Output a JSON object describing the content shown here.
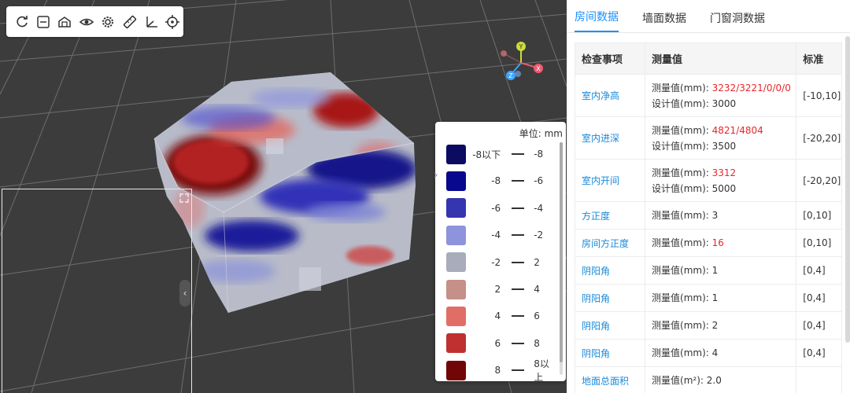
{
  "toolbar": {
    "tools": [
      {
        "name": "reset-view",
        "icon": "refresh-icon"
      },
      {
        "name": "minimize",
        "icon": "minus-square-icon"
      },
      {
        "name": "house-view",
        "icon": "house-icon"
      },
      {
        "name": "visibility",
        "icon": "eye-icon"
      },
      {
        "name": "settings",
        "icon": "gear-icon"
      },
      {
        "name": "measure",
        "icon": "ruler-icon"
      },
      {
        "name": "axes",
        "icon": "axes-icon"
      },
      {
        "name": "locate",
        "icon": "crosshair-icon"
      }
    ]
  },
  "gizmo": {
    "y": "Y",
    "x": "X",
    "z": "Z"
  },
  "legend": {
    "unit": "单位: mm",
    "rows": [
      {
        "lo": "-8以下",
        "hi": "-8",
        "color": "#0b0b62"
      },
      {
        "lo": "-8",
        "hi": "-6",
        "color": "#08088e"
      },
      {
        "lo": "-6",
        "hi": "-4",
        "color": "#3535b0"
      },
      {
        "lo": "-4",
        "hi": "-2",
        "color": "#8d93dc"
      },
      {
        "lo": "-2",
        "hi": "2",
        "color": "#a8acbb"
      },
      {
        "lo": "2",
        "hi": "4",
        "color": "#c49088"
      },
      {
        "lo": "4",
        "hi": "6",
        "color": "#e16e66"
      },
      {
        "lo": "6",
        "hi": "8",
        "color": "#c03030"
      },
      {
        "lo": "8",
        "hi": "8以上",
        "color": "#720606"
      }
    ]
  },
  "tabs": [
    {
      "label": "房间数据",
      "active": true
    },
    {
      "label": "墙面数据",
      "active": false
    },
    {
      "label": "门窗洞数据",
      "active": false
    }
  ],
  "table": {
    "headers": [
      "检查事项",
      "测量值",
      "标准"
    ],
    "rows": [
      {
        "item": "室内净高",
        "measured_label": "测量值(mm): ",
        "measured": [
          "3232",
          "3221",
          "0",
          "0",
          "0"
        ],
        "measured_red": true,
        "design": "设计值(mm): 3000",
        "std": "[-10,10]"
      },
      {
        "item": "室内进深",
        "measured_label": "测量值(mm): ",
        "measured": [
          "4821",
          "4804"
        ],
        "measured_red": true,
        "design": "设计值(mm): 3500",
        "std": "[-20,20]"
      },
      {
        "item": "室内开间",
        "measured_label": "测量值(mm): ",
        "measured": [
          "3312"
        ],
        "measured_red": true,
        "design": "设计值(mm): 5000",
        "std": "[-20,20]"
      },
      {
        "item": "方正度",
        "measured_label": "测量值(mm): ",
        "measured": [
          "3"
        ],
        "measured_red": false,
        "design": "",
        "std": "[0,10]"
      },
      {
        "item": "房间方正度",
        "measured_label": "测量值(mm): ",
        "measured": [
          "16"
        ],
        "measured_red": true,
        "design": "",
        "std": "[0,10]"
      },
      {
        "item": "阴阳角",
        "measured_label": "测量值(mm): ",
        "measured": [
          "1"
        ],
        "measured_red": false,
        "design": "",
        "std": "[0,4]"
      },
      {
        "item": "阴阳角",
        "measured_label": "测量值(mm): ",
        "measured": [
          "1"
        ],
        "measured_red": false,
        "design": "",
        "std": "[0,4]"
      },
      {
        "item": "阴阳角",
        "measured_label": "测量值(mm): ",
        "measured": [
          "2"
        ],
        "measured_red": false,
        "design": "",
        "std": "[0,4]"
      },
      {
        "item": "阴阳角",
        "measured_label": "测量值(mm): ",
        "measured": [
          "4"
        ],
        "measured_red": false,
        "design": "",
        "std": "[0,4]"
      },
      {
        "item": "地面总面积",
        "measured_label": "测量值(m²): ",
        "measured": [
          "2.0"
        ],
        "measured_red": false,
        "design": "",
        "std": ""
      }
    ]
  }
}
